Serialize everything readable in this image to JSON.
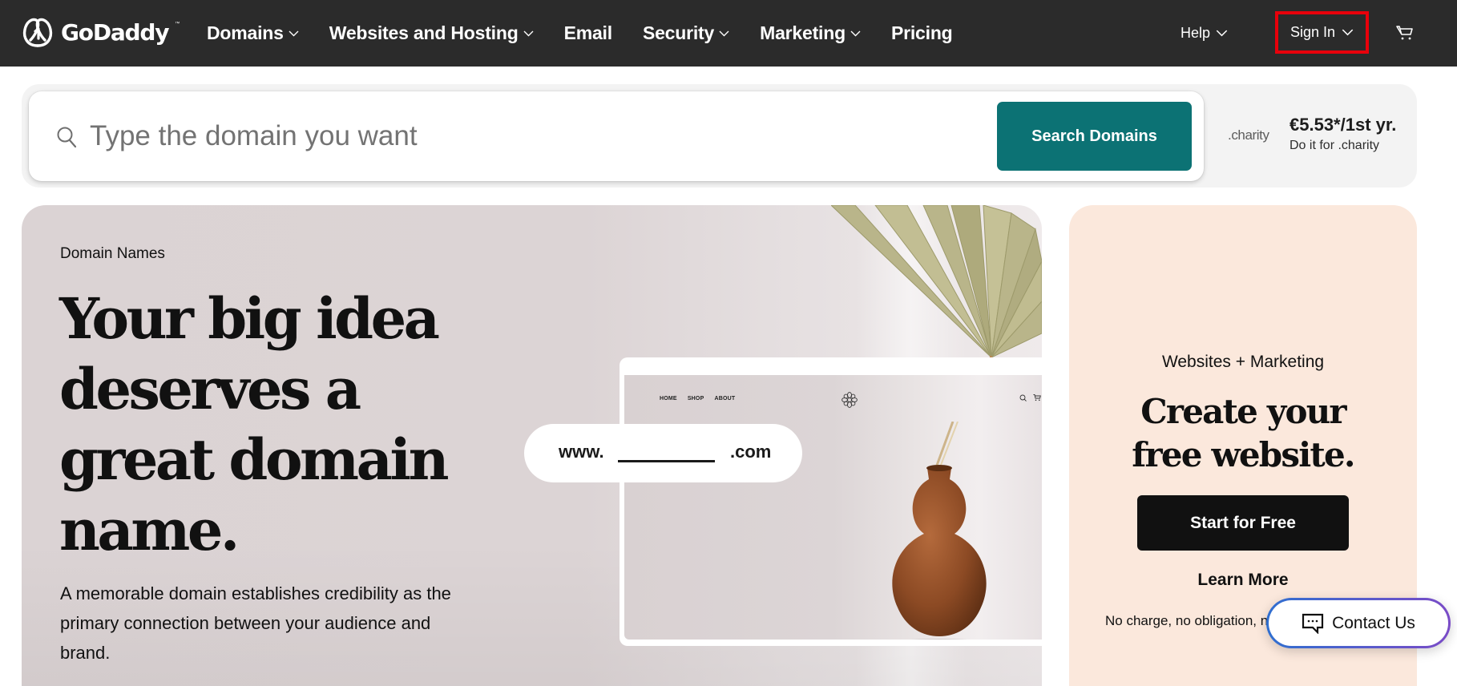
{
  "header": {
    "brand": "GoDaddy",
    "brand_tm": "™",
    "nav": [
      {
        "label": "Domains",
        "has_dropdown": true
      },
      {
        "label": "Websites and Hosting",
        "has_dropdown": true
      },
      {
        "label": "Email",
        "has_dropdown": false
      },
      {
        "label": "Security",
        "has_dropdown": true
      },
      {
        "label": "Marketing",
        "has_dropdown": true
      },
      {
        "label": "Pricing",
        "has_dropdown": false
      }
    ],
    "help_label": "Help",
    "signin_label": "Sign In",
    "highlight_color": "#e8000b",
    "cart_icon": "cart-icon"
  },
  "search": {
    "placeholder": "Type the domain you want",
    "value": "",
    "button_label": "Search Domains",
    "button_color": "#0c7274",
    "promo": {
      "tld": ".charity",
      "price": "€5.53*/1st yr.",
      "subtext": "Do it for .charity"
    }
  },
  "hero": {
    "eyebrow": "Domain Names",
    "title": "Your big idea deserves a great domain name.",
    "body": "A memorable domain establishes credibility as the primary connection between your audience and brand.",
    "url_pill": {
      "prefix": "www.",
      "suffix": ".com"
    },
    "mockup_nav": [
      "HOME",
      "SHOP",
      "ABOUT"
    ]
  },
  "side_card": {
    "eyebrow": "Websites + Marketing",
    "title": "Create your free website.",
    "cta_label": "Start for Free",
    "learn_more_label": "Learn More",
    "note": "No charge, no obligation, n",
    "bg_color": "#fbe8dc"
  },
  "chat": {
    "label": "Contact Us"
  }
}
